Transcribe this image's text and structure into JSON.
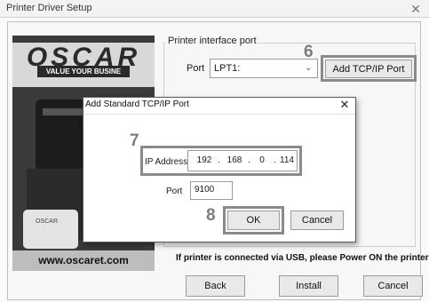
{
  "window": {
    "title": "Printer Driver Setup"
  },
  "sidebar": {
    "logo": "OSCAR",
    "tagline": "VALUE YOUR BUSINE",
    "device_label": "OSCAR",
    "website": "www.oscaret.com"
  },
  "interface": {
    "group_label": "Printer interface port",
    "port_label": "Port",
    "port_value": "LPT1:",
    "add_tcpip_label": "Add TCP/IP Port"
  },
  "usb_note": "If printer is connected via USB, please Power ON the printer",
  "footer": {
    "back_label": "Back",
    "install_label": "Install",
    "cancel_label": "Cancel"
  },
  "dialog": {
    "title": "Add Standard TCP/IP Port",
    "ip_label": "IP Address",
    "ip_octets": [
      "192",
      "168",
      "0",
      "114"
    ],
    "port_label": "Port",
    "port_value": "9100",
    "ok_label": "OK",
    "cancel_label": "Cancel"
  },
  "steps": {
    "add_port": "6",
    "ip_address": "7",
    "ok": "8"
  }
}
